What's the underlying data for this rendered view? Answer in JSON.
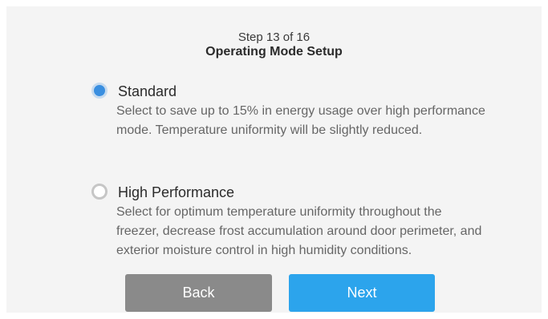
{
  "header": {
    "step": "Step 13 of 16",
    "title": "Operating Mode Setup"
  },
  "options": [
    {
      "label": "Standard",
      "description": "Select to save up to 15% in energy usage over high performance mode. Temperature uniformity will be slightly reduced.",
      "selected": true
    },
    {
      "label": "High Performance",
      "description": "Select for optimum temperature uniformity throughout the freezer, decrease frost accumulation around door perimeter, and exterior moisture control in high humidity conditions.",
      "selected": false
    }
  ],
  "buttons": {
    "back": "Back",
    "next": "Next"
  },
  "colors": {
    "accent": "#2ca4ec",
    "radio_selected": "#3a8fe0",
    "back_button": "#8a8a8a",
    "panel_background": "#f4f4f4"
  }
}
